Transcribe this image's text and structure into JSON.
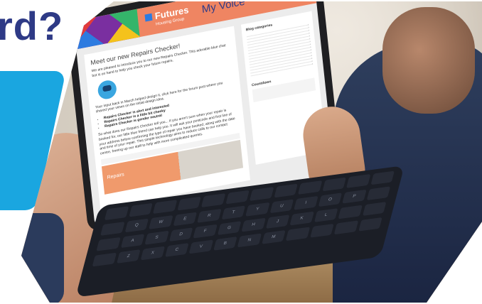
{
  "page": {
    "heading_fragment": "rd?",
    "accent_colors": {
      "navy": "#2e3a86",
      "blue": "#1aa6e0",
      "orange": "#ef8562"
    }
  },
  "tablet_site": {
    "brand": "Futures",
    "brand_sub": "Housing Group",
    "section_title": "My Voice",
    "article": {
      "title": "Meet our new Repairs Checker!",
      "intro": "We are pleased to introduce you to our new Repairs Checker. This adorable blue chat bot is on hand to help you check your future repairs.",
      "paragraph2": "Your input back in March helped design it, click here for the forum post where you shared your views on the initial design idea.",
      "bullets": [
        "Repairs Checker is alert and interested",
        "Repairs Checker is a little bit cheeky",
        "Repairs Checker is gender neutral"
      ],
      "paragraph3": "So what does our Repairs Checker tell you... If you aren't sure when your repair is booked for, our little blue friend can help you. It will ask your postcode and first line of your address before confirming the type of repair you have booked, along with the date and time of your repair. This simple technology aims to reduce calls to our contact centre, freeing up our staff to help with more complicated queries.",
      "preview_label": "Repairs"
    },
    "sidebar": {
      "title": "Blog categories",
      "items": [
        "",
        "",
        "",
        "",
        "",
        "",
        "",
        "",
        "",
        "",
        "",
        "",
        "",
        "",
        ""
      ],
      "countdown_title": "Countdown",
      "countdown_text": ""
    }
  },
  "keyboard": {
    "rows": [
      [
        "",
        "",
        "",
        "",
        "",
        "",
        "",
        "",
        "",
        "",
        "",
        ""
      ],
      [
        "",
        "Q",
        "W",
        "E",
        "R",
        "T",
        "Y",
        "U",
        "I",
        "O",
        "P",
        ""
      ],
      [
        "",
        "A",
        "S",
        "D",
        "F",
        "G",
        "H",
        "J",
        "K",
        "L",
        "",
        ""
      ],
      [
        "",
        "Z",
        "X",
        "C",
        "V",
        "B",
        "N",
        "M",
        "",
        "",
        "",
        ""
      ]
    ]
  }
}
